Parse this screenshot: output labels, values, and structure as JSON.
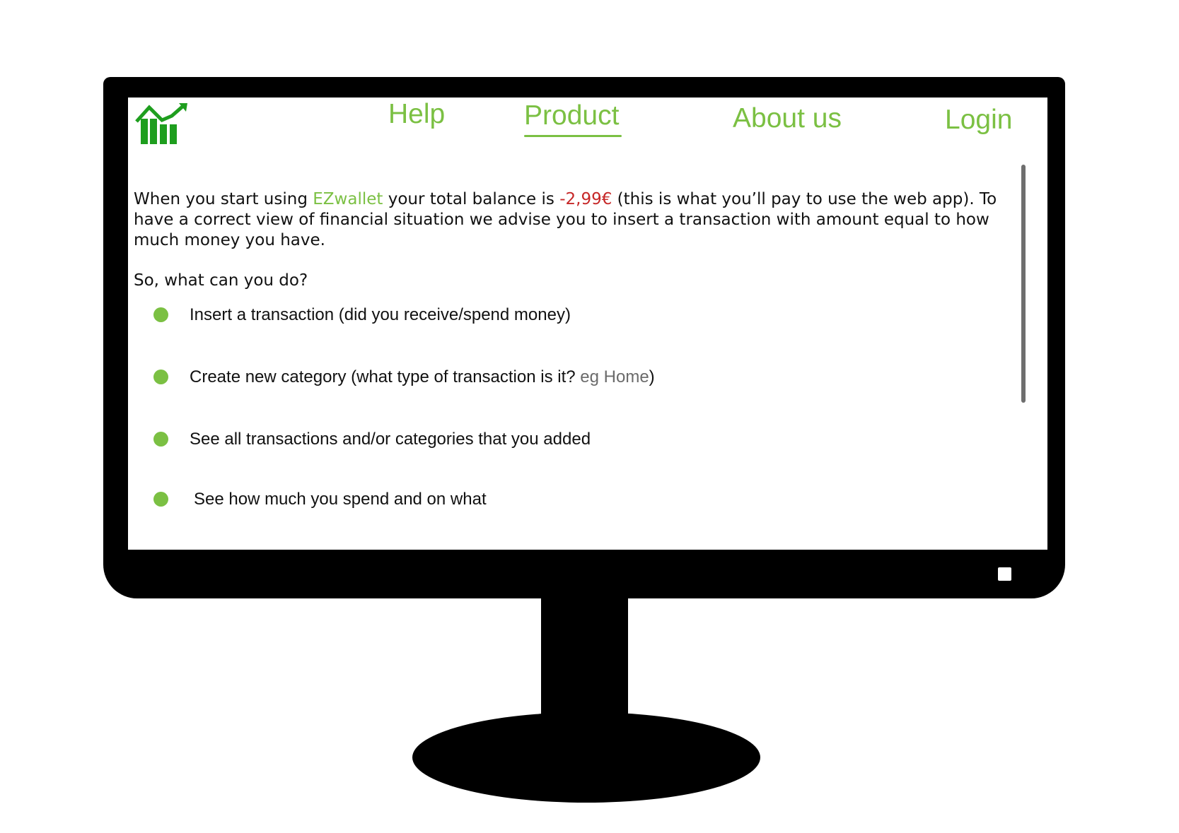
{
  "nav": {
    "help": "Help",
    "product": "Product",
    "about": "About us",
    "login": "Login"
  },
  "intro": {
    "part1": "When you start using ",
    "brand": "EZwallet",
    "part2": " your total balance is ",
    "balance": "-2,99€",
    "part3": " (this is what you’ll pay to use the web app). To have a correct view of financial situation we advise you to insert a transaction with amount equal to how much money you have."
  },
  "question": "So, what can you do?",
  "features": [
    {
      "text": "Insert a transaction (did you receive/spend money)"
    },
    {
      "text": "Create new category (what type of transaction is it? ",
      "example": "eg Home",
      "suffix": ")"
    },
    {
      "text": "See all transactions and/or categories that you added"
    },
    {
      "text": "See how much you spend and on what"
    }
  ],
  "colors": {
    "accent": "#7bc043",
    "logo": "#1e9e1e",
    "negative_balance": "#c62828",
    "example_text": "#6b6b6b",
    "bezel": "#000000"
  },
  "icons": {
    "logo": "bar-chart-growth-icon",
    "bullet": "green-dot-icon"
  }
}
